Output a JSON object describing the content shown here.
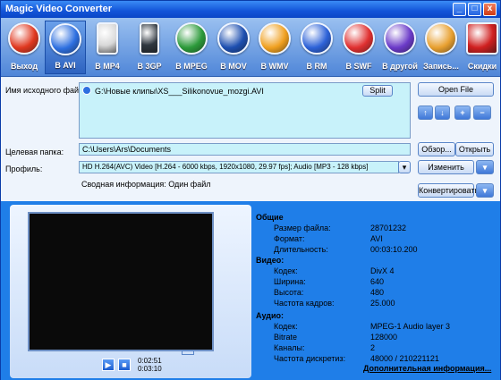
{
  "window": {
    "title": "Magic Video Converter",
    "controls": [
      "_",
      "□",
      "x"
    ]
  },
  "toolbar": {
    "items": [
      {
        "label": "Выход",
        "icon": "power-icon",
        "color": "#e03820"
      },
      {
        "label": "В AVI",
        "icon": "play-icon",
        "color": "#2d6fe0",
        "active": true
      },
      {
        "label": "В MP4",
        "icon": "ipod-icon",
        "color": "#d8d8d8"
      },
      {
        "label": "В 3GP",
        "icon": "phone-icon",
        "color": "#303840"
      },
      {
        "label": "В MPEG",
        "icon": "camera-icon",
        "color": "#2c9a3a"
      },
      {
        "label": "В MOV",
        "icon": "quicktime-icon",
        "color": "#1d4fb0"
      },
      {
        "label": "В WMV",
        "icon": "wmp-icon",
        "color": "#f0a020"
      },
      {
        "label": "В RM",
        "icon": "real-icon",
        "color": "#2d62d8"
      },
      {
        "label": "В SWF",
        "icon": "flash-icon",
        "color": "#e03030"
      },
      {
        "label": "В другой",
        "icon": "play-icon",
        "color": "#6b3ac8"
      },
      {
        "label": "Запись...",
        "icon": "burn-icon",
        "color": "#e8a030"
      },
      {
        "label": "Скидки",
        "icon": "box-icon",
        "color": "#d02020"
      }
    ]
  },
  "source": {
    "label": "Имя исходного файла:",
    "file": "G:\\Новые клипы\\XS___Silikonovue_mozgi.AVI",
    "split": "Split",
    "open_file": "Open File"
  },
  "target": {
    "label": "Целевая папка:",
    "value": "C:\\Users\\Ars\\Documents",
    "browse": "Обзор...",
    "open": "Открыть"
  },
  "profile": {
    "label": "Профиль:",
    "value": "HD  H.264(AVC) Video [H.264 - 6000 kbps, 1920x1080, 29.97 fps]; Audio [MP3 - 128 kbps]",
    "change": "Изменить",
    "summary": "Сводная информация: Один файл",
    "convert": "Конвертировать"
  },
  "player": {
    "time_current": "0:02:51",
    "time_total": "0:03:10"
  },
  "info": {
    "general_title": "Общие",
    "general": [
      {
        "k": "Размер файла:",
        "v": "28701232"
      },
      {
        "k": "Формат:",
        "v": "AVI"
      },
      {
        "k": "Длительность:",
        "v": "00:03:10.200"
      }
    ],
    "video_title": "Видео:",
    "video": [
      {
        "k": "Кодек:",
        "v": "DivX 4"
      },
      {
        "k": "Ширина:",
        "v": "640"
      },
      {
        "k": "Высота:",
        "v": "480"
      },
      {
        "k": "Частота кадров:",
        "v": "25.000"
      }
    ],
    "audio_title": "Аудио:",
    "audio": [
      {
        "k": "Кодек:",
        "v": "MPEG-1 Audio layer 3"
      },
      {
        "k": "Bitrate",
        "v": "128000"
      },
      {
        "k": "Каналы:",
        "v": "2"
      },
      {
        "k": "Частота дискретиз:",
        "v": "48000 / 210221121"
      }
    ],
    "more": "Дополнительная информация..."
  }
}
